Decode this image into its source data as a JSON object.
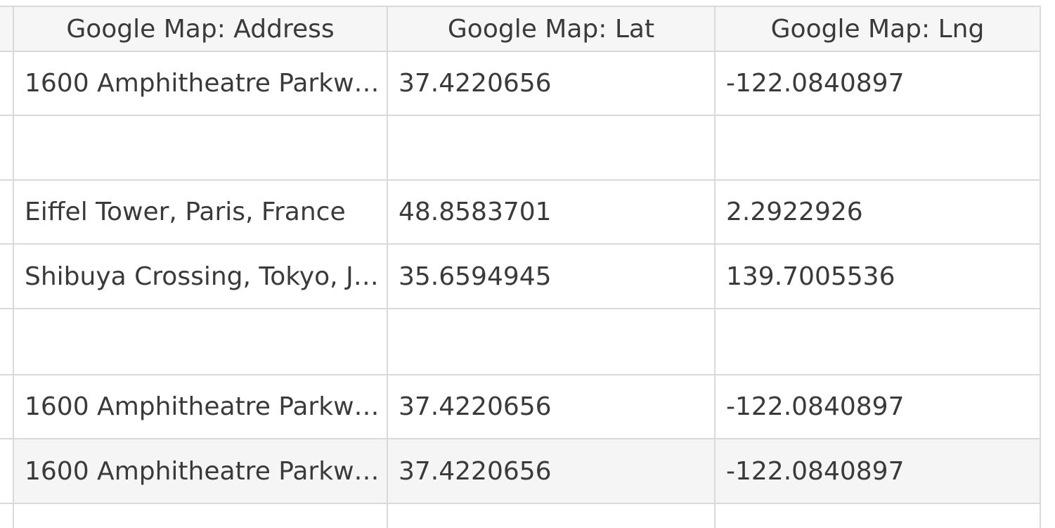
{
  "table": {
    "columns": [
      {
        "label": "Google Map: Address"
      },
      {
        "label": "Google Map: Lat"
      },
      {
        "label": "Google Map: Lng"
      }
    ],
    "rows": [
      {
        "address": "1600 Amphitheatre Parkwa...",
        "lat": "37.4220656",
        "lng": "-122.0840897"
      },
      {
        "address": "",
        "lat": "",
        "lng": ""
      },
      {
        "address": "Eiffel Tower, Paris, France",
        "lat": "48.8583701",
        "lng": "2.2922926"
      },
      {
        "address": "Shibuya Crossing, Tokyo, Ja...",
        "lat": "35.6594945",
        "lng": "139.7005536"
      },
      {
        "address": "",
        "lat": "",
        "lng": ""
      },
      {
        "address": "1600 Amphitheatre Parkwa...",
        "lat": "37.4220656",
        "lng": "-122.0840897"
      },
      {
        "address": "1600 Amphitheatre Parkwa...",
        "lat": "37.4220656",
        "lng": "-122.0840897"
      },
      {
        "address": "",
        "lat": "",
        "lng": ""
      }
    ]
  },
  "colors": {
    "border": "#d9d9d9",
    "header_bg": "#f6f6f6",
    "hover_row_bg": "#f5f5f5",
    "text": "#3a3a3a"
  }
}
